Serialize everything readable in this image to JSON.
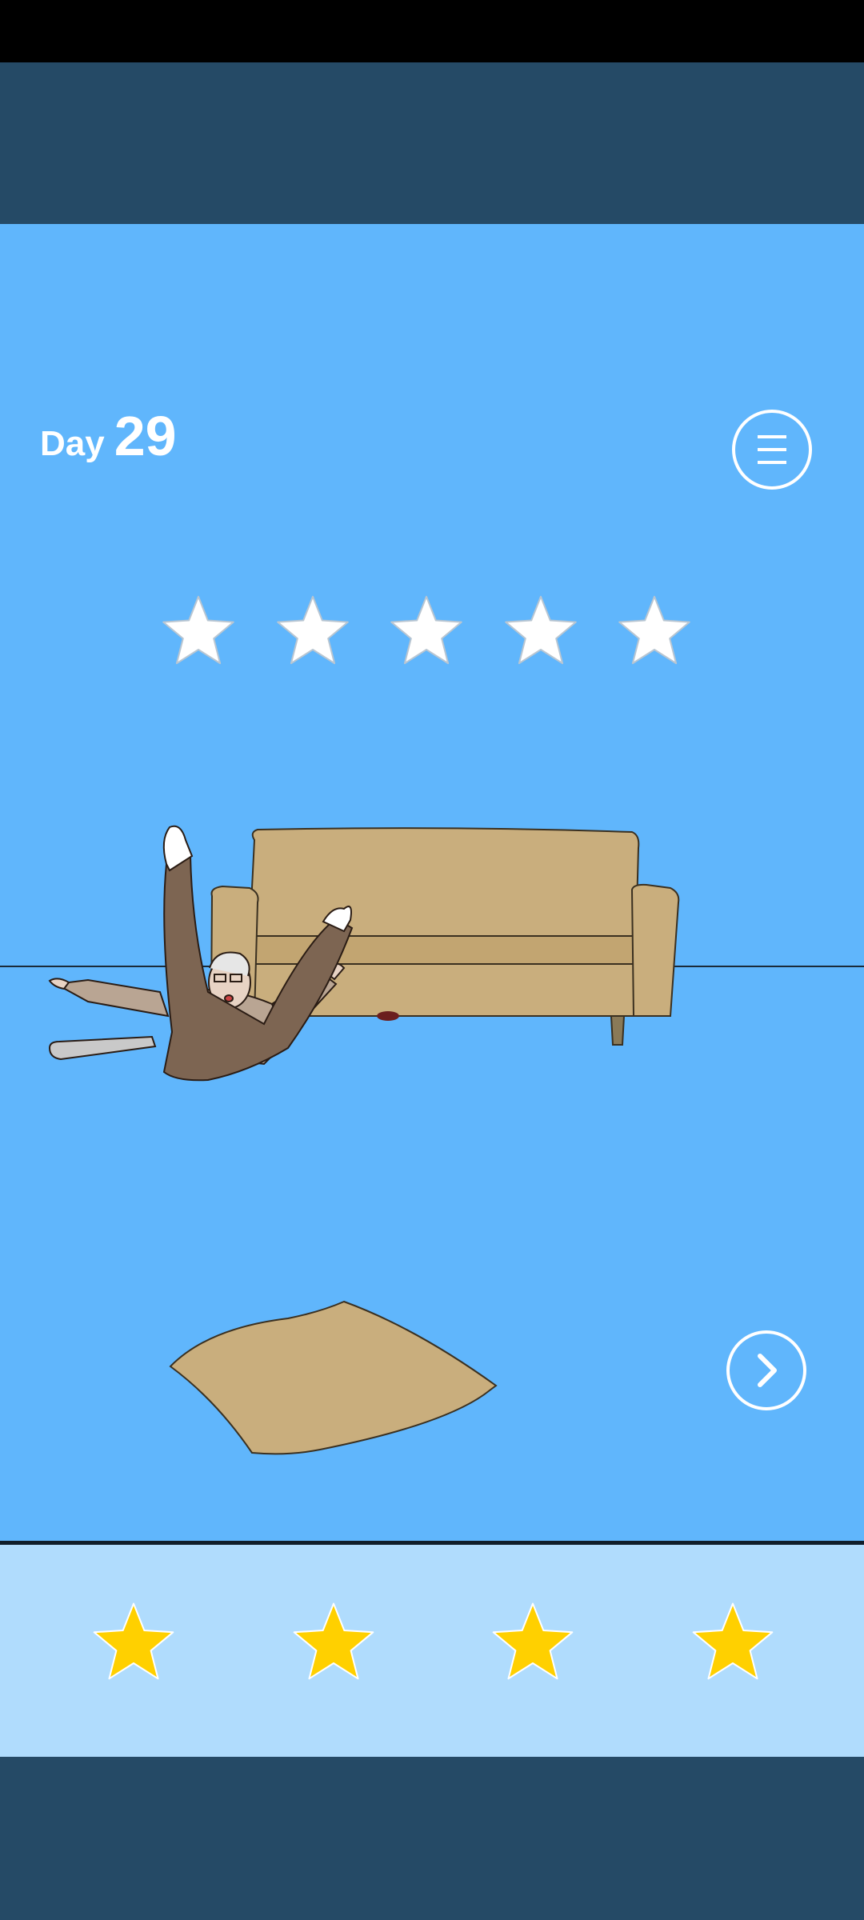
{
  "header": {
    "day_label": "Day",
    "day_number": "29"
  },
  "controls": {
    "menu_icon": "hamburger-menu-icon",
    "next_icon": "chevron-right-icon"
  },
  "rating": {
    "total_stars": 5,
    "earned_stars": 0,
    "empty_color": "#ffffff"
  },
  "hint_tray": {
    "star_count": 4,
    "star_color": "#ffd000"
  },
  "scene": {
    "objects": [
      "sofa",
      "fallen-old-man",
      "floor-cushion",
      "floor-line"
    ]
  },
  "colors": {
    "background_sky": "#60b6fc",
    "banner": "#254a66",
    "tray": "#b0dcfd",
    "sofa": "#c9ae7d"
  }
}
